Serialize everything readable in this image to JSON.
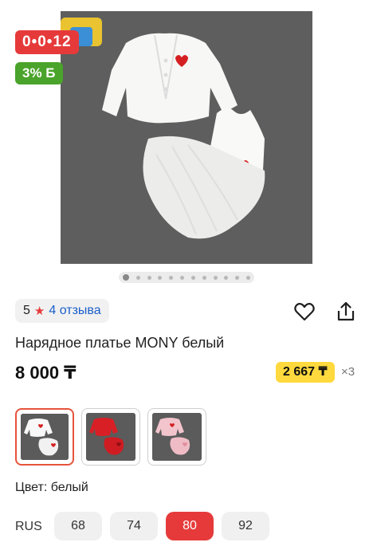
{
  "badges": {
    "timer": "0•0•12",
    "bonus": "3% Б"
  },
  "gallery": {
    "dots_count": 12,
    "active_dot": 0
  },
  "rating": {
    "value": "5",
    "reviews": "4 отзыва"
  },
  "product": {
    "title": "Нарядное платье MONY белый",
    "price": "8 000 ₸",
    "installment": "2 667 ₸",
    "installment_multiplier": "×3"
  },
  "colors": {
    "label": "Цвет: белый",
    "options": [
      {
        "name": "белый",
        "selected": true,
        "fabric": "#f8f8f8",
        "accent": "#d42020"
      },
      {
        "name": "красный",
        "selected": false,
        "fabric": "#d81f25",
        "accent": "#b31218"
      },
      {
        "name": "розовый",
        "selected": false,
        "fabric": "#f2c4cc",
        "accent": "#e28b9a"
      }
    ]
  },
  "sizes": {
    "label": "RUS",
    "options": [
      "68",
      "74",
      "80",
      "92"
    ],
    "selected": "80"
  },
  "colors_theme": {
    "accent_red": "#e63a3a",
    "link_blue": "#1a5ec9",
    "bonus_green": "#4aa32a",
    "installment_yellow": "#ffd93d"
  }
}
